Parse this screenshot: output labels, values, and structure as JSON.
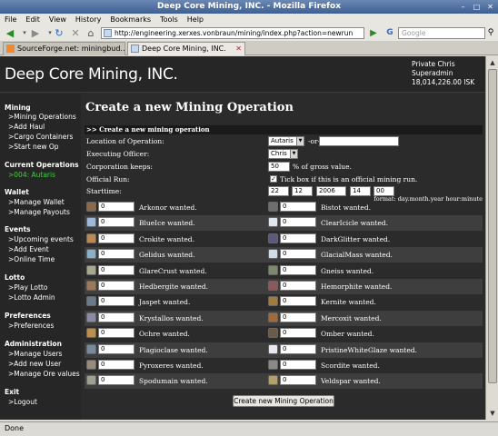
{
  "window": {
    "title": "Deep Core Mining, INC. - Mozilla Firefox"
  },
  "menu": [
    "File",
    "Edit",
    "View",
    "History",
    "Bookmarks",
    "Tools",
    "Help"
  ],
  "nav": {
    "url": "http://engineering.xerxes.vonbraun/mining/index.php?action=newrun",
    "search_placeholder": "Google",
    "search_engine": "G"
  },
  "tabs": [
    {
      "label": "SourceForge.net: miningbud..."
    },
    {
      "label": "Deep Core Mining, INC."
    }
  ],
  "header": {
    "brand": "Deep Core Mining, INC.",
    "user_line1": "Private  Chris",
    "user_line2": "Superadmin",
    "user_isk": "18,014,226.00  ISK"
  },
  "sidebar": {
    "mining": {
      "title": "Mining",
      "items": [
        ">Mining Operations",
        ">Add Haul",
        ">Cargo Containers",
        ">Start new Op"
      ]
    },
    "current": {
      "title": "Current Operations",
      "items": [
        ">004: Autaris"
      ]
    },
    "wallet": {
      "title": "Wallet",
      "items": [
        ">Manage Wallet",
        ">Manage Payouts"
      ]
    },
    "events": {
      "title": "Events",
      "items": [
        ">Upcoming events",
        ">Add Event",
        ">Online Time"
      ]
    },
    "lotto": {
      "title": "Lotto",
      "items": [
        ">Play Lotto",
        ">Lotto Admin"
      ]
    },
    "preferences": {
      "title": "Preferences",
      "items": [
        ">Preferences"
      ]
    },
    "administration": {
      "title": "Administration",
      "items": [
        ">Manage Users",
        ">Add new User",
        ">Manage Ore values"
      ]
    },
    "exit": {
      "title": "Exit",
      "items": [
        ">Logout"
      ]
    }
  },
  "form": {
    "page_title": "Create a new Mining Operation",
    "section_title": ">> Create a new mining operation",
    "location_label": "Location of Operation:",
    "location_value": "Autaris",
    "or_text": "-or-",
    "officer_label": "Executing Officer:",
    "officer_value": "Chris",
    "keeps_label": "Corporation keeps:",
    "keeps_value": "50",
    "keeps_suffix": "% of gross value.",
    "official_label": "Official Run:",
    "official_checked": true,
    "official_text": "Tick box if this is an official mining run.",
    "start_label": "Starttime:",
    "start_day": "22",
    "start_month": "12",
    "start_year": "2006",
    "start_hour": "14",
    "start_minute": "00",
    "format_hint": "format: day.month.year hour:minute",
    "submit_label": "Create new Mining Operation"
  },
  "ores": [
    {
      "name": "Arkonor wanted.",
      "value": "0",
      "icon_color": "#8a6a4a"
    },
    {
      "name": "Bistot wanted.",
      "value": "0",
      "icon_color": "#6e6e6e"
    },
    {
      "name": "BlueIce wanted.",
      "value": "0",
      "icon_color": "#9fb8d8"
    },
    {
      "name": "ClearIcicle wanted.",
      "value": "0",
      "icon_color": "#e0e6ee"
    },
    {
      "name": "Crokite wanted.",
      "value": "0",
      "icon_color": "#b88a5a"
    },
    {
      "name": "DarkGlitter wanted.",
      "value": "0",
      "icon_color": "#5a5a7a"
    },
    {
      "name": "Gelidus wanted.",
      "value": "0",
      "icon_color": "#8ab0c8"
    },
    {
      "name": "GlacialMass wanted.",
      "value": "0",
      "icon_color": "#d0dce8"
    },
    {
      "name": "GlareCrust wanted.",
      "value": "0",
      "icon_color": "#a8a890"
    },
    {
      "name": "Gneiss wanted.",
      "value": "0",
      "icon_color": "#7a8a6a"
    },
    {
      "name": "Hedbergite wanted.",
      "value": "0",
      "icon_color": "#9a7a5a"
    },
    {
      "name": "Hemorphite wanted.",
      "value": "0",
      "icon_color": "#8a5a5a"
    },
    {
      "name": "Jaspet wanted.",
      "value": "0",
      "icon_color": "#6a7a8a"
    },
    {
      "name": "Kernite wanted.",
      "value": "0",
      "icon_color": "#a07a40"
    },
    {
      "name": "Krystallos wanted.",
      "value": "0",
      "icon_color": "#8a8aa0"
    },
    {
      "name": "Mercoxit wanted.",
      "value": "0",
      "icon_color": "#a06a3a"
    },
    {
      "name": "Ochre wanted.",
      "value": "0",
      "icon_color": "#b89050"
    },
    {
      "name": "Omber wanted.",
      "value": "0",
      "icon_color": "#6a5a4a"
    },
    {
      "name": "Plagioclase wanted.",
      "value": "0",
      "icon_color": "#7a8a9a"
    },
    {
      "name": "PristineWhiteGlaze wanted.",
      "value": "0",
      "icon_color": "#e8e8f0"
    },
    {
      "name": "Pyroxeres wanted.",
      "value": "0",
      "icon_color": "#9a8a7a"
    },
    {
      "name": "Scordite wanted.",
      "value": "0",
      "icon_color": "#8a8a8a"
    },
    {
      "name": "Spodumain wanted.",
      "value": "0",
      "icon_color": "#a0a090"
    },
    {
      "name": "Veldspar wanted.",
      "value": "0",
      "icon_color": "#b0a070"
    }
  ],
  "status": {
    "text": "Done"
  }
}
